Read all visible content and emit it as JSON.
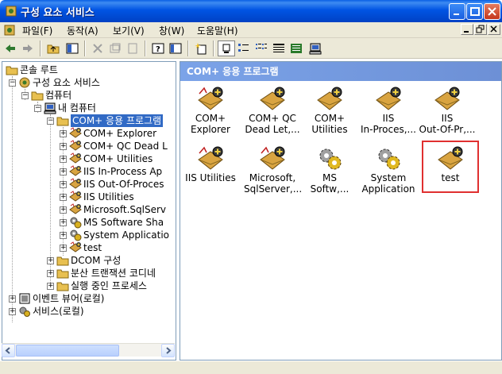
{
  "window": {
    "title": "구성 요소 서비스"
  },
  "menu": [
    "파일(F)",
    "동작(A)",
    "보기(V)",
    "창(W)",
    "도움말(H)"
  ],
  "tree": {
    "root": "콘솔 루트",
    "component_services": "구성 요소 서비스",
    "computers": "컴퓨터",
    "my_computer": "내 컴퓨터",
    "com_apps": "COM+ 응용 프로그램",
    "apps": [
      "COM+ Explorer",
      "COM+ QC Dead L",
      "COM+ Utilities",
      "IIS In-Process Ap",
      "IIS Out-Of-Proces",
      "IIS Utilities",
      "Microsoft.SqlServ",
      "MS Software Sha",
      "System Applicatio",
      "test"
    ],
    "dcom": "DCOM 구성",
    "dtc": "분산 트랜잭션 코디네",
    "running": "실행 중인 프로세스",
    "event_viewer": "이벤트 뷰어(로컬)",
    "services": "서비스(로컬)"
  },
  "right": {
    "header": "COM+ 응용 프로그램",
    "items": [
      {
        "l1": "COM+",
        "l2": "Explorer",
        "icon": "com-app-icon"
      },
      {
        "l1": "COM+ QC",
        "l2": "Dead Let,...",
        "icon": "com-app-icon"
      },
      {
        "l1": "COM+",
        "l2": "Utilities",
        "icon": "com-app-icon"
      },
      {
        "l1": "IIS",
        "l2": "In-Proces,...",
        "icon": "com-app-icon"
      },
      {
        "l1": "IIS",
        "l2": "Out-Of-Pr,...",
        "icon": "com-app-icon"
      },
      {
        "l1": "IIS Utilities",
        "l2": "",
        "icon": "com-app-icon"
      },
      {
        "l1": "Microsoft,",
        "l2": "SqlServer,...",
        "icon": "com-app-icon"
      },
      {
        "l1": "MS",
        "l2": "Softw,...",
        "icon": "gear-app-icon"
      },
      {
        "l1": "System",
        "l2": "Application",
        "icon": "gear-app-icon"
      },
      {
        "l1": "test",
        "l2": "",
        "icon": "com-app-icon"
      }
    ]
  },
  "colors": {
    "titlebar": "#0054e3",
    "header": "#7ba3e8",
    "selection": "#316ac5",
    "highlight_border": "#e03030"
  }
}
